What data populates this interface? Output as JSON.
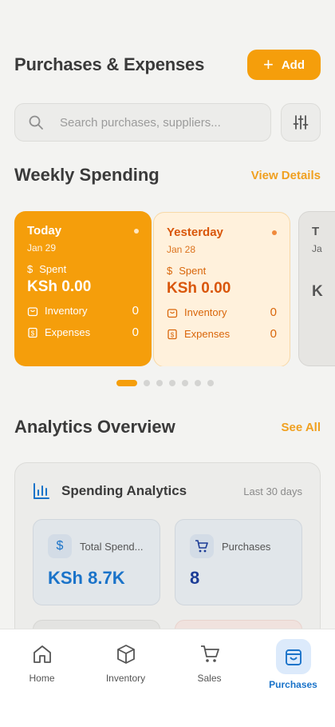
{
  "header": {
    "title": "Purchases & Expenses",
    "add_label": "Add"
  },
  "search": {
    "placeholder": "Search purchases, suppliers..."
  },
  "weekly": {
    "title": "Weekly Spending",
    "link": "View Details",
    "cards": [
      {
        "day": "Today",
        "date": "Jan 29",
        "spent_label": "Spent",
        "amount": "KSh 0.00",
        "inventory_label": "Inventory",
        "inventory": "0",
        "expenses_label": "Expenses",
        "expenses": "0"
      },
      {
        "day": "Yesterday",
        "date": "Jan 28",
        "spent_label": "Spent",
        "amount": "KSh 0.00",
        "inventory_label": "Inventory",
        "inventory": "0",
        "expenses_label": "Expenses",
        "expenses": "0"
      },
      {
        "day": "T",
        "date": "Ja",
        "amount": "K"
      }
    ],
    "page_count": 7,
    "active_page": 1
  },
  "analytics": {
    "title": "Analytics Overview",
    "link": "See All",
    "card_title": "Spending Analytics",
    "range": "Last 30 days",
    "stats": [
      {
        "label": "Total Spend...",
        "value": "KSh 8.7K"
      },
      {
        "label": "Purchases",
        "value": "8"
      }
    ]
  },
  "nav": {
    "items": [
      {
        "label": "Home",
        "icon": "home-icon"
      },
      {
        "label": "Inventory",
        "icon": "box-icon"
      },
      {
        "label": "Sales",
        "icon": "cart-icon"
      },
      {
        "label": "Purchases",
        "icon": "bag-icon"
      }
    ],
    "active": "Purchases"
  },
  "colors": {
    "accent": "#f59e0b",
    "active_blue": "#1a73c9",
    "background": "#f3f3f1"
  }
}
